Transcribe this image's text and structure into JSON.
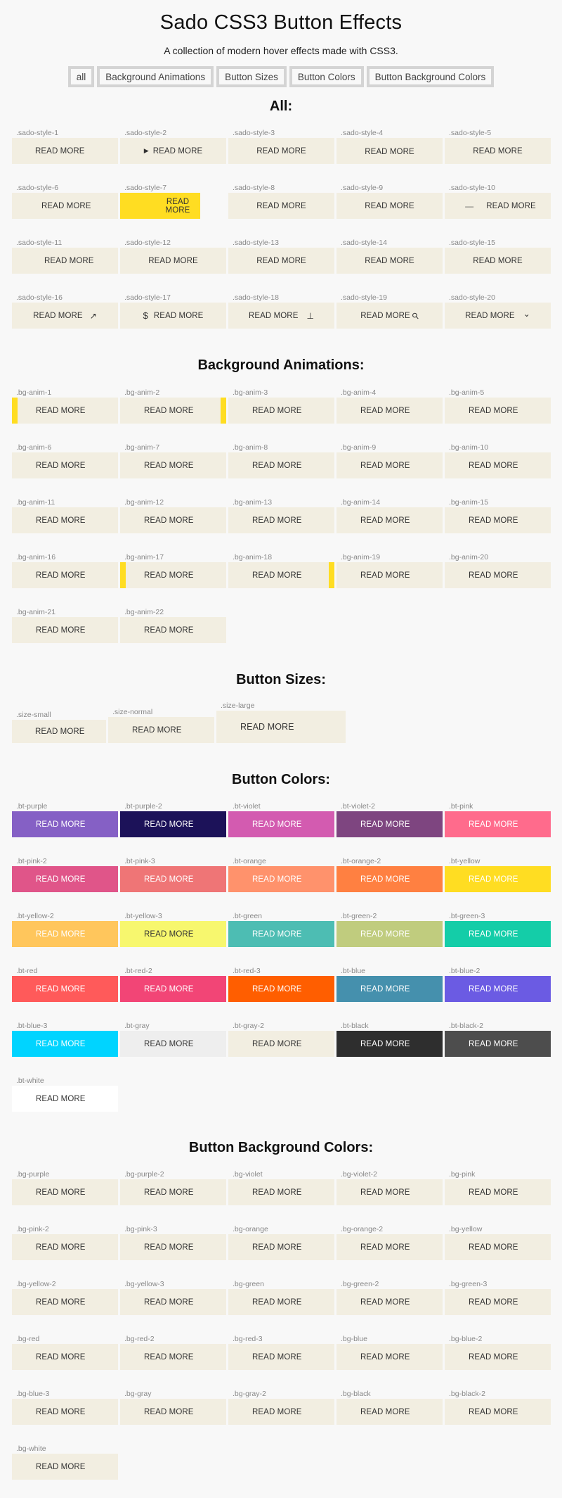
{
  "header": {
    "title": "Sado CSS3 Button Effects",
    "subtitle": "A collection of modern hover effects made with CSS3."
  },
  "filters": [
    "all",
    "Background Animations",
    "Button Sizes",
    "Button Colors",
    "Button Background Colors"
  ],
  "button_label": "READ MORE",
  "sections": {
    "all": {
      "title": "All:",
      "items": [
        {
          "label": ".sado-style-1",
          "icon": null
        },
        {
          "label": ".sado-style-2",
          "icon": "play-triangle-icon",
          "glyph": "▶"
        },
        {
          "label": ".sado-style-3",
          "icon": null
        },
        {
          "label": ".sado-style-4",
          "icon": null
        },
        {
          "label": ".sado-style-5",
          "icon": null
        },
        {
          "label": ".sado-style-6",
          "icon": null
        },
        {
          "label": ".sado-style-7",
          "icon": null,
          "accent": "#ffdd22"
        },
        {
          "label": ".sado-style-8",
          "icon": null
        },
        {
          "label": ".sado-style-9",
          "icon": null
        },
        {
          "label": ".sado-style-10",
          "icon": "dash-icon",
          "glyph": "—"
        },
        {
          "label": ".sado-style-11",
          "icon": null
        },
        {
          "label": ".sado-style-12",
          "icon": null
        },
        {
          "label": ".sado-style-13",
          "icon": null
        },
        {
          "label": ".sado-style-14",
          "icon": null
        },
        {
          "label": ".sado-style-15",
          "icon": null
        },
        {
          "label": ".sado-style-16",
          "icon": "arrow-up-right-icon",
          "glyph": "↗"
        },
        {
          "label": ".sado-style-17",
          "icon": "dollar-icon",
          "glyph": "$"
        },
        {
          "label": ".sado-style-18",
          "icon": "up-tack-icon",
          "glyph": "⊥"
        },
        {
          "label": ".sado-style-19",
          "icon": "search-icon",
          "glyph": "⚲"
        },
        {
          "label": ".sado-style-20",
          "icon": "chevron-down-icon",
          "glyph": "⌄"
        }
      ]
    },
    "bg_anim": {
      "title": "Background Animations:",
      "items": [
        {
          "label": ".bg-anim-1",
          "bar": "left"
        },
        {
          "label": ".bg-anim-2",
          "bar": "right"
        },
        {
          "label": ".bg-anim-3",
          "bar": null
        },
        {
          "label": ".bg-anim-4",
          "bar": null
        },
        {
          "label": ".bg-anim-5",
          "bar": null
        },
        {
          "label": ".bg-anim-6",
          "bar": null
        },
        {
          "label": ".bg-anim-7",
          "bar": null
        },
        {
          "label": ".bg-anim-8",
          "bar": null
        },
        {
          "label": ".bg-anim-9",
          "bar": null
        },
        {
          "label": ".bg-anim-10",
          "bar": null
        },
        {
          "label": ".bg-anim-11",
          "bar": null
        },
        {
          "label": ".bg-anim-12",
          "bar": null
        },
        {
          "label": ".bg-anim-13",
          "bar": null
        },
        {
          "label": ".bg-anim-14",
          "bar": null
        },
        {
          "label": ".bg-anim-15",
          "bar": null
        },
        {
          "label": ".bg-anim-16",
          "bar": null
        },
        {
          "label": ".bg-anim-17",
          "bar": "left"
        },
        {
          "label": ".bg-anim-18",
          "bar": "right"
        },
        {
          "label": ".bg-anim-19",
          "bar": null
        },
        {
          "label": ".bg-anim-20",
          "bar": null
        },
        {
          "label": ".bg-anim-21",
          "bar": null
        },
        {
          "label": ".bg-anim-22",
          "bar": null
        }
      ],
      "accent": "#ffdd22"
    },
    "sizes": {
      "title": "Button Sizes:",
      "items": [
        {
          "label": ".size-small"
        },
        {
          "label": ".size-normal"
        },
        {
          "label": ".size-large"
        }
      ]
    },
    "colors": {
      "title": "Button Colors:",
      "items": [
        {
          "label": ".bt-purple",
          "bg": "#8560c5",
          "fg": "#ffffff"
        },
        {
          "label": ".bt-purple-2",
          "bg": "#1c1259",
          "fg": "#ffffff"
        },
        {
          "label": ".bt-violet",
          "bg": "#d35bb0",
          "fg": "#ffffff"
        },
        {
          "label": ".bt-violet-2",
          "bg": "#7e4580",
          "fg": "#ffffff"
        },
        {
          "label": ".bt-pink",
          "bg": "#ff6b8c",
          "fg": "#ffffff"
        },
        {
          "label": ".bt-pink-2",
          "bg": "#e05589",
          "fg": "#ffffff"
        },
        {
          "label": ".bt-pink-3",
          "bg": "#ef7576",
          "fg": "#ffffff"
        },
        {
          "label": ".bt-orange",
          "bg": "#ff926c",
          "fg": "#ffffff"
        },
        {
          "label": ".bt-orange-2",
          "bg": "#ff8041",
          "fg": "#ffffff"
        },
        {
          "label": ".bt-yellow",
          "bg": "#ffdd22",
          "fg": "#ffffff"
        },
        {
          "label": ".bt-yellow-2",
          "bg": "#ffc65c",
          "fg": "#ffffff"
        },
        {
          "label": ".bt-yellow-3",
          "bg": "#f7f76e",
          "fg": "#333333"
        },
        {
          "label": ".bt-green",
          "bg": "#4dbdb3",
          "fg": "#ffffff"
        },
        {
          "label": ".bt-green-2",
          "bg": "#c0cc7e",
          "fg": "#ffffff"
        },
        {
          "label": ".bt-green-3",
          "bg": "#14cda8",
          "fg": "#ffffff"
        },
        {
          "label": ".bt-red",
          "bg": "#ff5a5a",
          "fg": "#ffffff"
        },
        {
          "label": ".bt-red-2",
          "bg": "#f24576",
          "fg": "#ffffff"
        },
        {
          "label": ".bt-red-3",
          "bg": "#ff5e00",
          "fg": "#ffffff"
        },
        {
          "label": ".bt-blue",
          "bg": "#4590ad",
          "fg": "#ffffff"
        },
        {
          "label": ".bt-blue-2",
          "bg": "#6b5be3",
          "fg": "#ffffff"
        },
        {
          "label": ".bt-blue-3",
          "bg": "#00d4ff",
          "fg": "#ffffff"
        },
        {
          "label": ".bt-gray",
          "bg": "#eeeeee",
          "fg": "#333333"
        },
        {
          "label": ".bt-gray-2",
          "bg": "#f2eee1",
          "fg": "#333333"
        },
        {
          "label": ".bt-black",
          "bg": "#2e2e2e",
          "fg": "#ffffff"
        },
        {
          "label": ".bt-black-2",
          "bg": "#4d4d4d",
          "fg": "#ffffff"
        },
        {
          "label": ".bt-white",
          "bg": "#ffffff",
          "fg": "#333333"
        }
      ]
    },
    "bg_colors": {
      "title": "Button Background Colors:",
      "items": [
        {
          "label": ".bg-purple"
        },
        {
          "label": ".bg-purple-2"
        },
        {
          "label": ".bg-violet"
        },
        {
          "label": ".bg-violet-2"
        },
        {
          "label": ".bg-pink"
        },
        {
          "label": ".bg-pink-2"
        },
        {
          "label": ".bg-pink-3"
        },
        {
          "label": ".bg-orange"
        },
        {
          "label": ".bg-orange-2"
        },
        {
          "label": ".bg-yellow"
        },
        {
          "label": ".bg-yellow-2"
        },
        {
          "label": ".bg-yellow-3"
        },
        {
          "label": ".bg-green"
        },
        {
          "label": ".bg-green-2"
        },
        {
          "label": ".bg-green-3"
        },
        {
          "label": ".bg-red"
        },
        {
          "label": ".bg-red-2"
        },
        {
          "label": ".bg-red-3"
        },
        {
          "label": ".bg-blue"
        },
        {
          "label": ".bg-blue-2"
        },
        {
          "label": ".bg-blue-3"
        },
        {
          "label": ".bg-gray"
        },
        {
          "label": ".bg-gray-2"
        },
        {
          "label": ".bg-black"
        },
        {
          "label": ".bg-black-2"
        },
        {
          "label": ".bg-white"
        }
      ]
    }
  },
  "colors": {
    "page_bg": "#f8f8f8",
    "button_bg": "#f2eee1",
    "accent_yellow": "#ffdd22",
    "filter_border": "#d4d4d4"
  }
}
